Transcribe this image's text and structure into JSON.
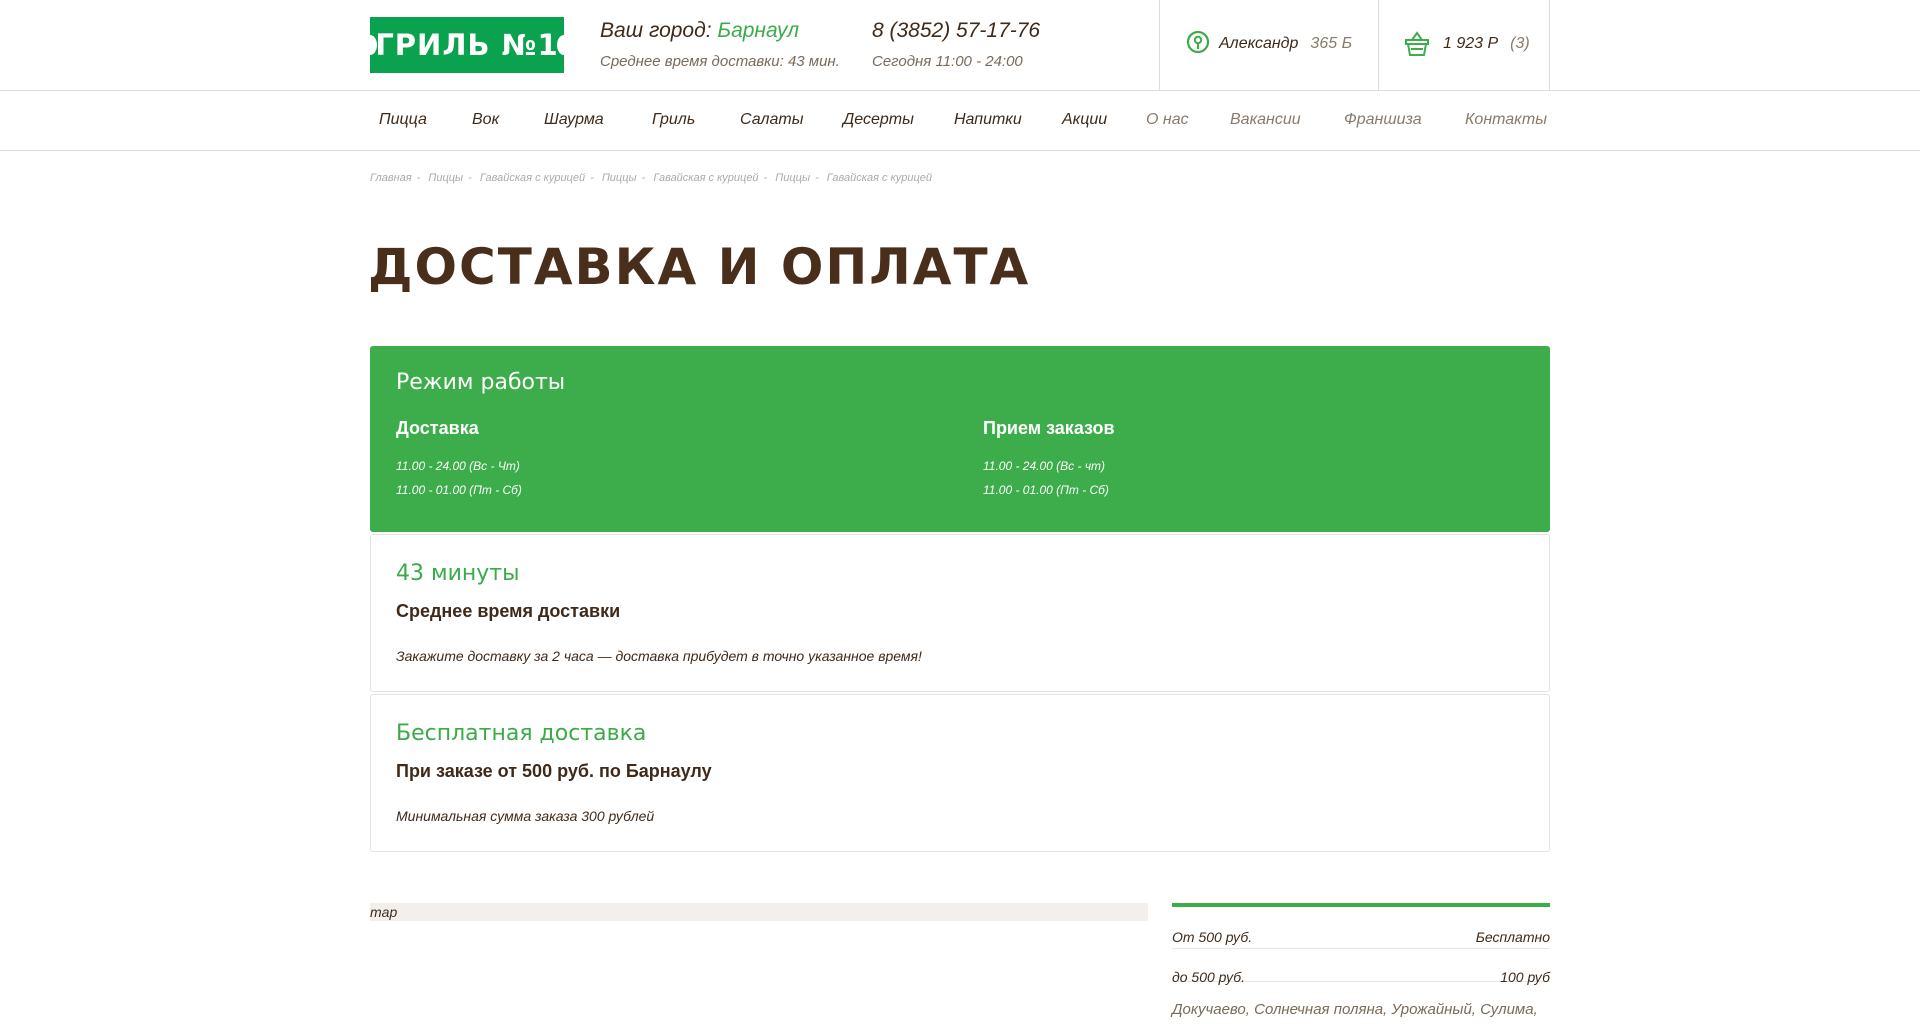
{
  "header": {
    "logo_text": "ГРИЛЬ №1",
    "city_label": "Ваш город:",
    "city_name": "Барнаул",
    "avg_delivery": "Среднее время доставки: 43 мин.",
    "phone": "8 (3852) 57-17-76",
    "hours": "Сегодня 11:00 - 24:00",
    "user_name": "Александр",
    "user_points": "365 Б",
    "cart_sum": "1 923 Р",
    "cart_count": "(3)"
  },
  "nav": {
    "items": [
      "Пицца",
      "Вок",
      "Шаурма",
      "Гриль",
      "Салаты",
      "Десерты",
      "Напитки",
      "Акции",
      "О нас",
      "Вакансии",
      "Франшиза",
      "Контакты"
    ]
  },
  "breadcrumb": [
    "Главная",
    "Пиццы",
    "Гавайская с курицей",
    "Пиццы",
    "Гавайская с курицей",
    "Пиццы",
    "Гавайская с курицей"
  ],
  "page_title": "ДОСТАВКА И ОПЛАТА",
  "schedule": {
    "title": "Режим работы",
    "delivery": {
      "title": "Доставка",
      "lines": [
        "11.00 - 24.00 (Вс - Чт)",
        "11.00 - 01.00 (Пт - Сб)"
      ]
    },
    "orders": {
      "title": "Прием заказов",
      "lines": [
        "11.00 - 24.00 (Вс - чт)",
        "11.00 - 01.00 (Пт - Сб)"
      ]
    }
  },
  "avg_block": {
    "title": "43 минуты",
    "subtitle": "Среднее время доставки",
    "text": "Закажите доставку за 2 часа — доставка прибудет в точно указанное время!"
  },
  "free_block": {
    "title": "Бесплатная доставка",
    "subtitle": "При заказе от 500 руб. по Барнаулу",
    "text": "Минимальная сумма заказа 300 рублей"
  },
  "map_label": "map",
  "prices": [
    {
      "label": "От 500 руб.",
      "value": "Бесплатно"
    },
    {
      "label": "до 500 руб.",
      "value": "100 руб"
    }
  ],
  "areas": "Докучаево, Солнечная поляна, Урожайный, Сулима,",
  "colors": {
    "brand_green": "#3dad4c",
    "logo_green": "#0aa24f",
    "text_brown": "#4a2e1c"
  }
}
